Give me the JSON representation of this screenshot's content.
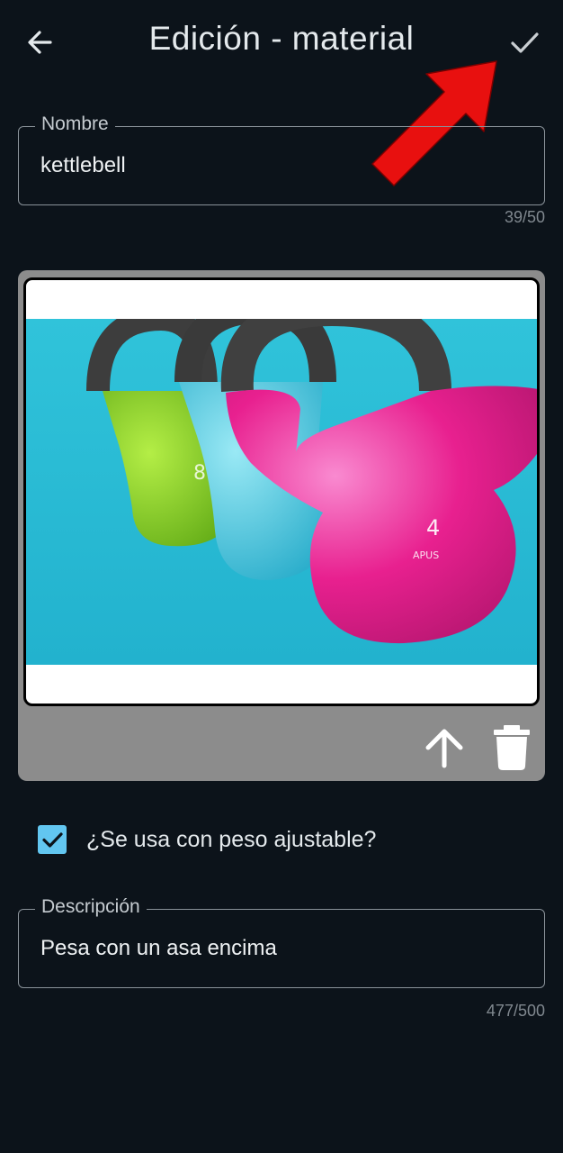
{
  "header": {
    "title": "Edición - material",
    "back_icon": "arrow-left-icon",
    "save_icon": "check-icon"
  },
  "annotation": {
    "icon": "red-pointer-arrow",
    "color": "#e8100f"
  },
  "name_field": {
    "label": "Nombre",
    "value": "kettlebell",
    "counter": "39/50"
  },
  "image_card": {
    "photo_description_icon": "kettlebell-photo",
    "upload_icon": "arrow-up-icon",
    "delete_icon": "trash-icon"
  },
  "adjustable_weight": {
    "label": "¿Se usa con peso ajustable?",
    "checked": true
  },
  "description_field": {
    "label": "Descripción",
    "value": "Pesa con un asa encima",
    "counter": "477/500"
  },
  "colors": {
    "background": "#0c131a",
    "accent_checkbox": "#62c6f0",
    "card_gray": "#8c8c8c",
    "photo_bg": "#29bcd4",
    "kettlebell_pink": "#e8208f",
    "kettlebell_green": "#7cc51a",
    "kettlebell_cyan": "#3fc6e2"
  }
}
